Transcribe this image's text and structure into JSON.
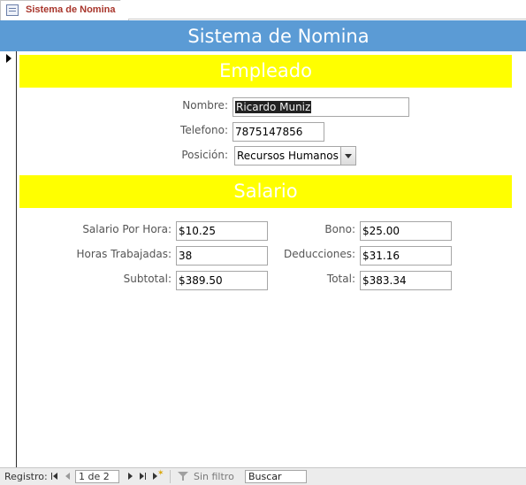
{
  "tab": {
    "label": "Sistema de Nomina",
    "icon": "form-icon"
  },
  "form": {
    "title": "Sistema de Nomina"
  },
  "empleado": {
    "section_title": "Empleado",
    "nombre_label": "Nombre:",
    "nombre_value": "Ricardo Muniz",
    "telefono_label": "Telefono:",
    "telefono_value": "7875147856",
    "posicion_label": "Posición:",
    "posicion_value": "Recursos Humanos"
  },
  "salario": {
    "section_title": "Salario",
    "salario_hora_label": "Salario Por Hora:",
    "salario_hora_value": "$10.25",
    "horas_label": "Horas Trabajadas:",
    "horas_value": "38",
    "subtotal_label": "Subtotal:",
    "subtotal_value": "$389.50",
    "bono_label": "Bono:",
    "bono_value": "$25.00",
    "deducciones_label": "Deducciones:",
    "deducciones_value": "$31.16",
    "total_label": "Total:",
    "total_value": "$383.34"
  },
  "navigation": {
    "label": "Registro:",
    "record": "1 de 2",
    "filter_label": "Sin filtro",
    "search_value": "Buscar"
  },
  "colors": {
    "header_band": "#5b9bd5",
    "section_band": "#ffff00",
    "tab_label": "#a8352b"
  }
}
